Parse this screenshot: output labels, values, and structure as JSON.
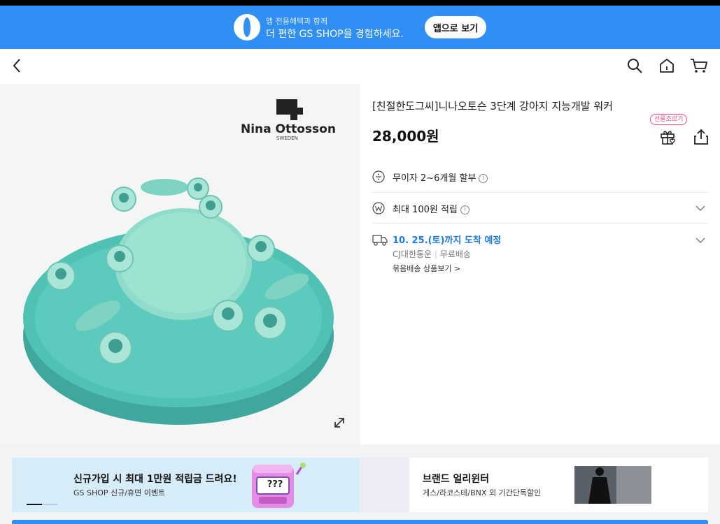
{
  "app_banner": {
    "line1": "앱 전용혜택과 함께",
    "line2": "더 편한 GS SHOP을 경험하세요.",
    "open_button": "앱으로 보기"
  },
  "nav": {
    "back_icon": "chevron-left-icon",
    "search_icon": "search-icon",
    "home_icon": "home-icon",
    "cart_icon": "cart-icon"
  },
  "product": {
    "image_brand": "Nina Ottosson",
    "image_brand_sub": "SWEDEN",
    "title": "[친절한도그씨]니나오토슨 3단계 강아지 지능개발 워커",
    "price": "28,000원",
    "gift_badge": "선물조르기"
  },
  "benefits": {
    "installment": "무이자 2~6개월 할부",
    "points": "최대 100원 적립",
    "delivery_date": "10. 25.(토)까지 도착 예정",
    "courier": "CJ대한통운",
    "shipping_fee": "무료배송",
    "bundle_link": "묶음배송 상품보기 >"
  },
  "promos": {
    "left_title": "신규가입 시 최대 1만원 적립금 드려요!",
    "left_sub": "GS SHOP 신규/휴면 이벤트",
    "left_badge": "???",
    "right_title": "브랜드 얼리윈터",
    "right_sub": "게스/라코스테/BNX 외 기간단독할인"
  },
  "colors": {
    "brand_blue": "#2f8ff5",
    "gift_pink": "#f24b8c",
    "delivery_blue": "#1a7ae8",
    "toy_teal": "#4fc2b4"
  }
}
